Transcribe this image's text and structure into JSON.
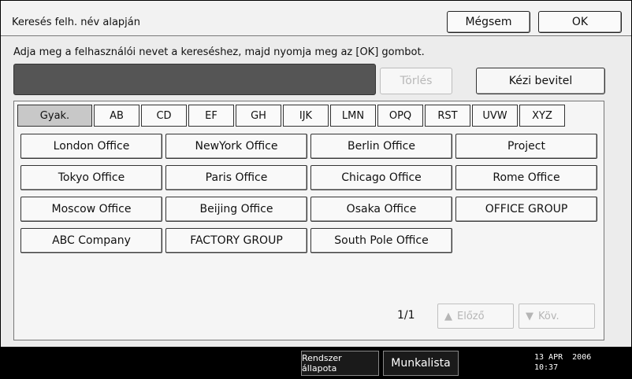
{
  "header": {
    "title": "Keresés felh. név alapján",
    "cancel_label": "Mégsem",
    "ok_label": "OK"
  },
  "instruction": "Adja meg a felhasználói nevet a kereséshez, majd nyomja meg az [OK] gombot.",
  "search": {
    "value": "",
    "clear_label": "Törlés",
    "manual_input_label": "Kézi bevitel"
  },
  "tabs": [
    "Gyak.",
    "AB",
    "CD",
    "EF",
    "GH",
    "IJK",
    "LMN",
    "OPQ",
    "RST",
    "UVW",
    "XYZ"
  ],
  "active_tab": "Gyak.",
  "destinations": [
    "London Office",
    "NewYork Office",
    "Berlin Office",
    "Project",
    "Tokyo Office",
    "Paris Office",
    "Chicago Office",
    "Rome Office",
    "Moscow Office",
    "Beijing Office",
    "Osaka Office",
    "OFFICE GROUP",
    "ABC Company",
    "FACTORY GROUP",
    "South Pole Office"
  ],
  "pagination": {
    "indicator": "1/1",
    "prev_label": "Előző",
    "next_label": "Köv."
  },
  "status_bar": {
    "system_status_label": "Rendszer állapota",
    "job_list_label": "Munkalista",
    "date": "13 APR  2006",
    "time": "10:37"
  }
}
